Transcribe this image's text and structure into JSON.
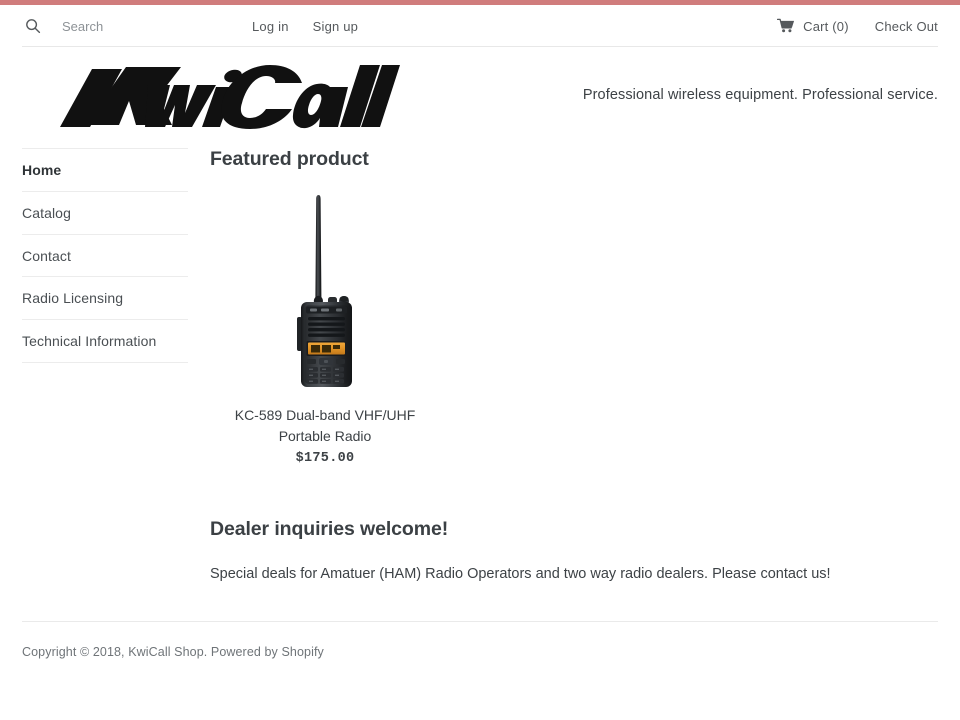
{
  "theme": {
    "accent_bar_color": "#d07c7c",
    "text_color": "#3d4246",
    "muted_text_color": "#6f7478",
    "divider_color": "#ececec"
  },
  "utility_bar": {
    "search": {
      "icon": "search-icon",
      "placeholder": "Search",
      "value": ""
    },
    "login_label": "Log in",
    "signup_label": "Sign up",
    "cart": {
      "icon": "shopping-cart-icon",
      "label": "Cart (0)",
      "count": 0
    },
    "checkout_label": "Check Out"
  },
  "masthead": {
    "logo_text": "KwiCall",
    "tagline": "Professional wireless equipment. Professional service."
  },
  "sidebar": {
    "items": [
      {
        "label": "Home",
        "active": true
      },
      {
        "label": "Catalog",
        "active": false
      },
      {
        "label": "Contact",
        "active": false
      },
      {
        "label": "Radio Licensing",
        "active": false
      },
      {
        "label": "Technical Information",
        "active": false
      }
    ]
  },
  "main": {
    "featured_heading": "Featured product",
    "product": {
      "title": "KC-589 Dual-band VHF/UHF Portable Radio",
      "price": "$175.00",
      "image_alt": "handheld-two-way-radio"
    },
    "dealer_heading": "Dealer inquiries welcome!",
    "dealer_text": "Special deals for Amatuer (HAM) Radio Operators and two way radio dealers. Please contact us!"
  },
  "footer": {
    "copyright": "Copyright © 2018, KwiCall Shop. Powered by Shopify"
  }
}
